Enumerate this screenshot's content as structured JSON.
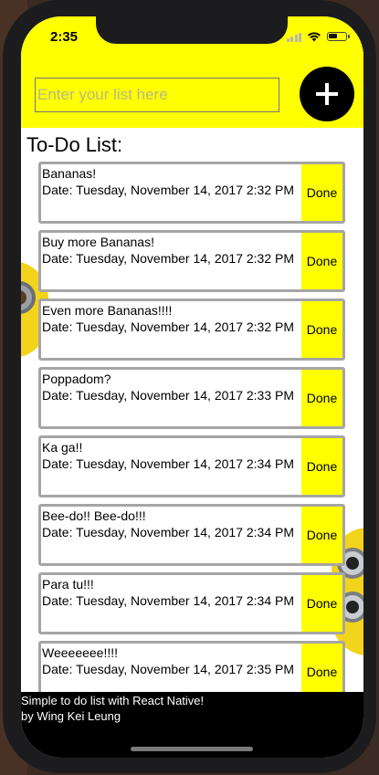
{
  "status_bar": {
    "time": "2:35"
  },
  "header": {
    "input_placeholder": "Enter your list here",
    "input_value": "",
    "add_button_label": "+"
  },
  "main": {
    "title": "To-Do List:",
    "items": [
      {
        "text": "Bananas!",
        "date": "Date: Tuesday, November 14, 2017 2:32 PM",
        "done_label": "Done"
      },
      {
        "text": "Buy more Bananas!",
        "date": "Date: Tuesday, November 14, 2017 2:32 PM",
        "done_label": "Done"
      },
      {
        "text": "Even more Bananas!!!!",
        "date": "Date: Tuesday, November 14, 2017 2:32 PM",
        "done_label": "Done"
      },
      {
        "text": "Poppadom?",
        "date": "Date: Tuesday, November 14, 2017 2:33 PM",
        "done_label": "Done"
      },
      {
        "text": "Ka ga!!",
        "date": "Date: Tuesday, November 14, 2017 2:34 PM",
        "done_label": "Done"
      },
      {
        "text": "Bee-do!! Bee-do!!!",
        "date": "Date: Tuesday, November 14, 2017 2:34 PM",
        "done_label": "Done"
      },
      {
        "text": "Para tu!!!",
        "date": "Date: Tuesday, November 14, 2017 2:34 PM",
        "done_label": "Done"
      },
      {
        "text": "Weeeeeee!!!!",
        "date": "Date: Tuesday, November 14, 2017 2:35 PM",
        "done_label": "Done"
      }
    ]
  },
  "footer": {
    "line1": "Simple to do list with React Native!",
    "line2": "by Wing Kei Leung"
  },
  "colors": {
    "accent": "#ffff00",
    "item_border": "#a5a5a5",
    "footer_bg": "#000000"
  }
}
